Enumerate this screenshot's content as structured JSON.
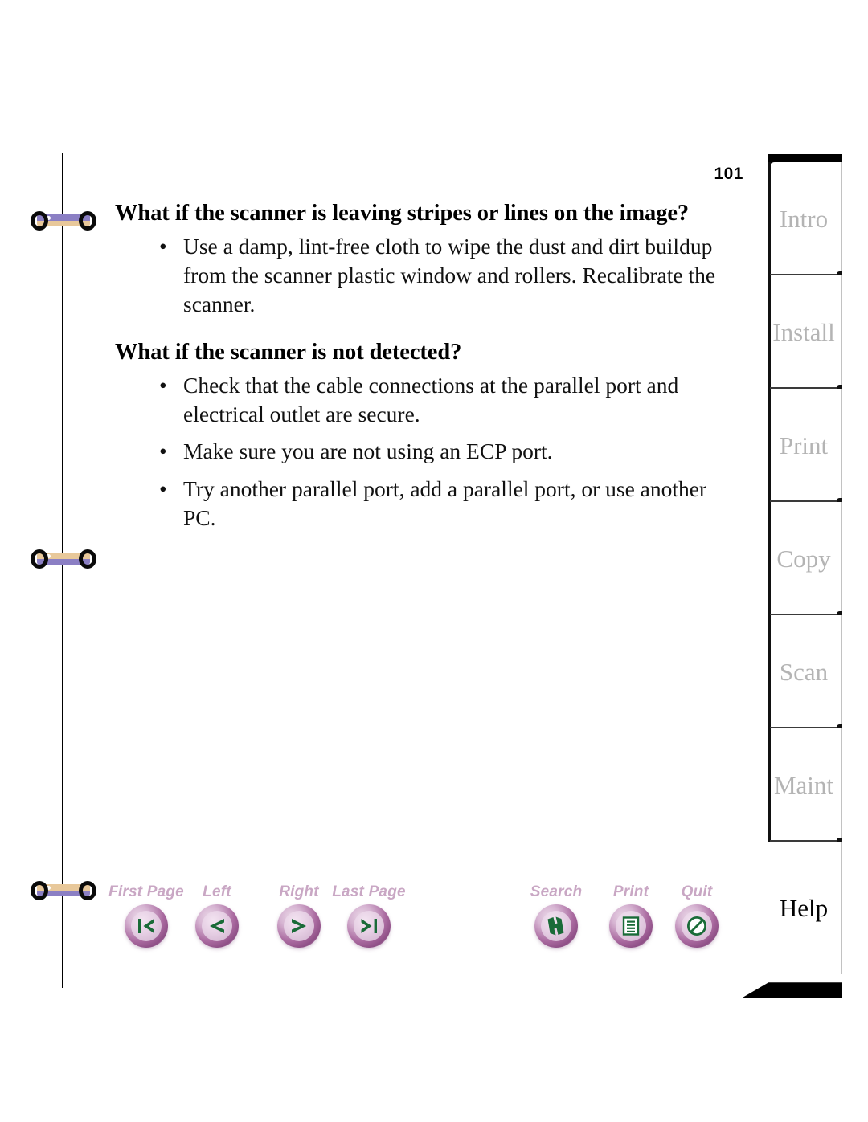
{
  "page": {
    "number": "101"
  },
  "content": {
    "sections": [
      {
        "heading": "What if the scanner is leaving stripes or lines on the image?",
        "items": [
          "Use a damp, lint-free cloth to wipe the dust and dirt buildup from the scanner plastic window and rollers. Recalibrate the scanner."
        ]
      },
      {
        "heading": "What if the scanner is not detected?",
        "items": [
          "Check that the cable connections at the parallel port and electrical outlet are secure.",
          "Make sure you are not using an ECP port.",
          "Try another parallel port, add a parallel port, or use another PC."
        ]
      }
    ],
    "bullet_glyph": "•"
  },
  "tabs": {
    "items": [
      {
        "label": "Intro",
        "active": false
      },
      {
        "label": "Install",
        "active": false
      },
      {
        "label": "Print",
        "active": false
      },
      {
        "label": "Copy",
        "active": false
      },
      {
        "label": "Scan",
        "active": false
      },
      {
        "label": "Maint",
        "active": false
      },
      {
        "label": "Help",
        "active": true
      }
    ],
    "inactive_color": "#b4b4b4",
    "active_color": "#000000"
  },
  "navbar": {
    "buttons": [
      {
        "label": "First Page",
        "icon": "first-page-icon"
      },
      {
        "label": "Left",
        "icon": "previous-page-icon"
      },
      {
        "label": "Right",
        "icon": "next-page-icon"
      },
      {
        "label": "Last Page",
        "icon": "last-page-icon"
      },
      {
        "label": "Search",
        "icon": "search-binoculars-icon"
      },
      {
        "label": "Print",
        "icon": "print-document-icon"
      },
      {
        "label": "Quit",
        "icon": "quit-no-entry-icon"
      }
    ],
    "label_color": "#c9a7c4",
    "glyph_color": "#1a6b38",
    "ring_color": "#a9699f"
  },
  "binder": {
    "rings": [
      {
        "name": "binder-ring-top"
      },
      {
        "name": "binder-ring-middle"
      },
      {
        "name": "binder-ring-bottom"
      }
    ],
    "bar_color_upper": "#e8c89a",
    "bar_color_lower": "#8b7fc4"
  }
}
